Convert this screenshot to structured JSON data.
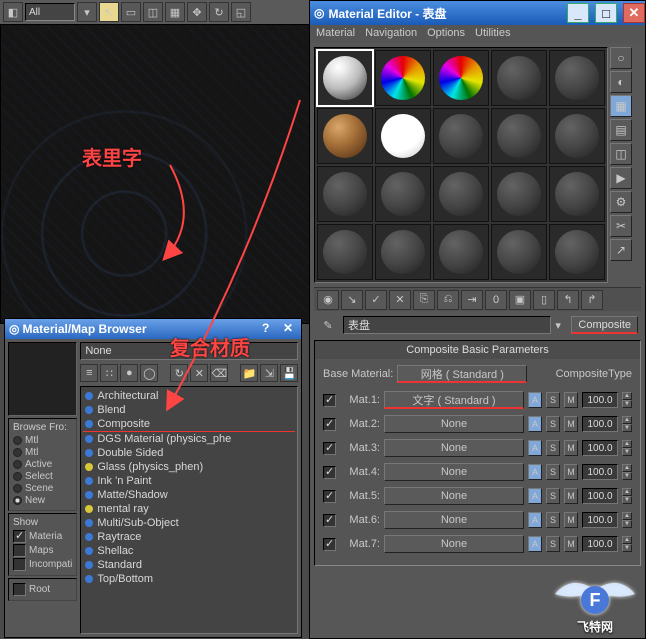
{
  "top_toolbar": {
    "selector_value": "All"
  },
  "material_editor": {
    "title": "Material Editor - 表盘",
    "menus": [
      "Material",
      "Navigation",
      "Options",
      "Utilities"
    ],
    "name_field": "表盘",
    "type_button": "Composite",
    "rollout_title": "Composite Basic Parameters",
    "base_material_label": "Base Material:",
    "base_material_button": "网格  ( Standard )",
    "composite_type_label": "CompositeType",
    "mats": [
      {
        "label": "Mat.1:",
        "button": "文字  ( Standard )",
        "val": "100.0",
        "checked": true,
        "underline": true
      },
      {
        "label": "Mat.2:",
        "button": "None",
        "val": "100.0",
        "checked": true
      },
      {
        "label": "Mat.3:",
        "button": "None",
        "val": "100.0",
        "checked": true
      },
      {
        "label": "Mat.4:",
        "button": "None",
        "val": "100.0",
        "checked": true
      },
      {
        "label": "Mat.5:",
        "button": "None",
        "val": "100.0",
        "checked": true
      },
      {
        "label": "Mat.6:",
        "button": "None",
        "val": "100.0",
        "checked": true
      },
      {
        "label": "Mat.7:",
        "button": "None",
        "val": "100.0",
        "checked": true
      }
    ]
  },
  "browser": {
    "title": "Material/Map Browser",
    "combo": "None",
    "browse_from_label": "Browse Fro:",
    "browse_from": [
      "Mtl",
      "Mtl",
      "Active",
      "Select",
      "Scene",
      "New"
    ],
    "browse_from_sel": 5,
    "show_label": "Show",
    "show": [
      "Materia",
      "Maps",
      "Incompati"
    ],
    "root_label": "Root",
    "list": [
      {
        "t": "Architectural"
      },
      {
        "t": "Blend"
      },
      {
        "t": "Composite",
        "ul": true
      },
      {
        "t": "DGS Material (physics_phe"
      },
      {
        "t": "Double Sided"
      },
      {
        "t": "Glass (physics_phen)",
        "y": true
      },
      {
        "t": "Ink 'n Paint"
      },
      {
        "t": "Matte/Shadow"
      },
      {
        "t": "mental ray",
        "y": true
      },
      {
        "t": "Multi/Sub-Object"
      },
      {
        "t": "Raytrace"
      },
      {
        "t": "Shellac"
      },
      {
        "t": "Standard"
      },
      {
        "t": "Top/Bottom"
      }
    ]
  },
  "annotations": {
    "a1": "表里字",
    "a2": "复合材质"
  },
  "watermark": "飞特网"
}
